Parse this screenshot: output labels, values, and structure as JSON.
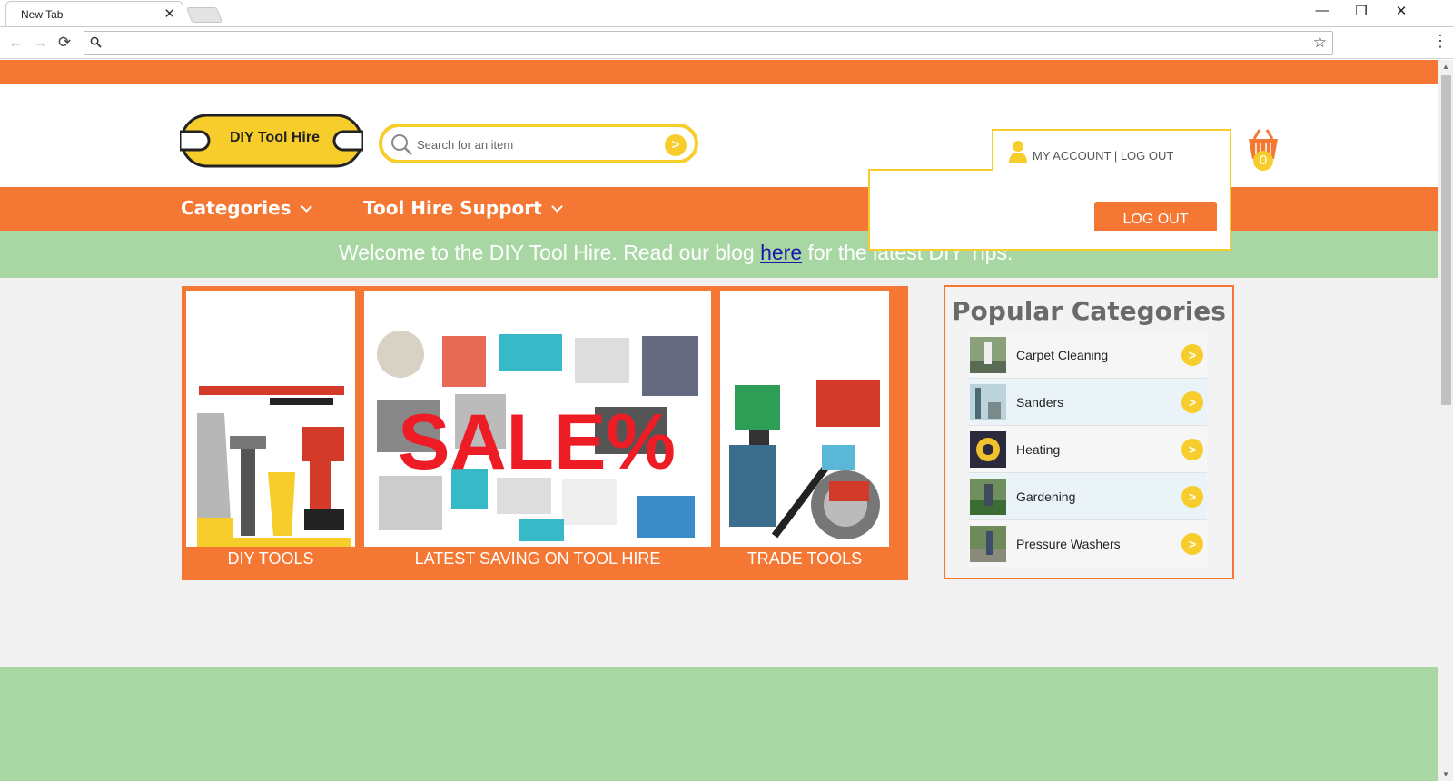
{
  "browser": {
    "tab_title": "New Tab",
    "tab_close": "✕",
    "omnibox_value": "",
    "win_minimize": "—",
    "win_restore": "❐",
    "win_close": "✕",
    "back": "←",
    "forward": "→",
    "reload": "⟳",
    "bookmark_star": "☆",
    "menu": "⋮"
  },
  "header": {
    "logo_text": "DIY Tool Hire",
    "search_placeholder": "Search for an item",
    "search_go": ">",
    "account_link": "MY ACCOUNT",
    "separator": " | ",
    "logout_link": "LOG OUT",
    "basket_count": "0"
  },
  "nav": {
    "items": [
      {
        "label": "Categories"
      },
      {
        "label": "Tool Hire Support"
      }
    ]
  },
  "welcome": {
    "before": "Welcome to the DIY Tool Hire. Read our blog ",
    "link": "here",
    "after": " for the latest DIY Tips."
  },
  "dropdown": {
    "logout_button": "LOG OUT"
  },
  "promo": {
    "tiles": [
      {
        "label": "DIY TOOLS"
      },
      {
        "label": "LATEST SAVING ON TOOL HIRE",
        "overlay": "SALE%"
      },
      {
        "label": "TRADE TOOLS"
      }
    ]
  },
  "popular": {
    "title": "Popular Categories",
    "go": ">",
    "items": [
      {
        "name": "Carpet Cleaning"
      },
      {
        "name": "Sanders"
      },
      {
        "name": "Heating"
      },
      {
        "name": "Gardening"
      },
      {
        "name": "Pressure Washers"
      }
    ]
  },
  "colors": {
    "brand_orange": "#f47734",
    "brand_yellow": "#f6cd2b",
    "band_green": "#a9d7a3"
  }
}
